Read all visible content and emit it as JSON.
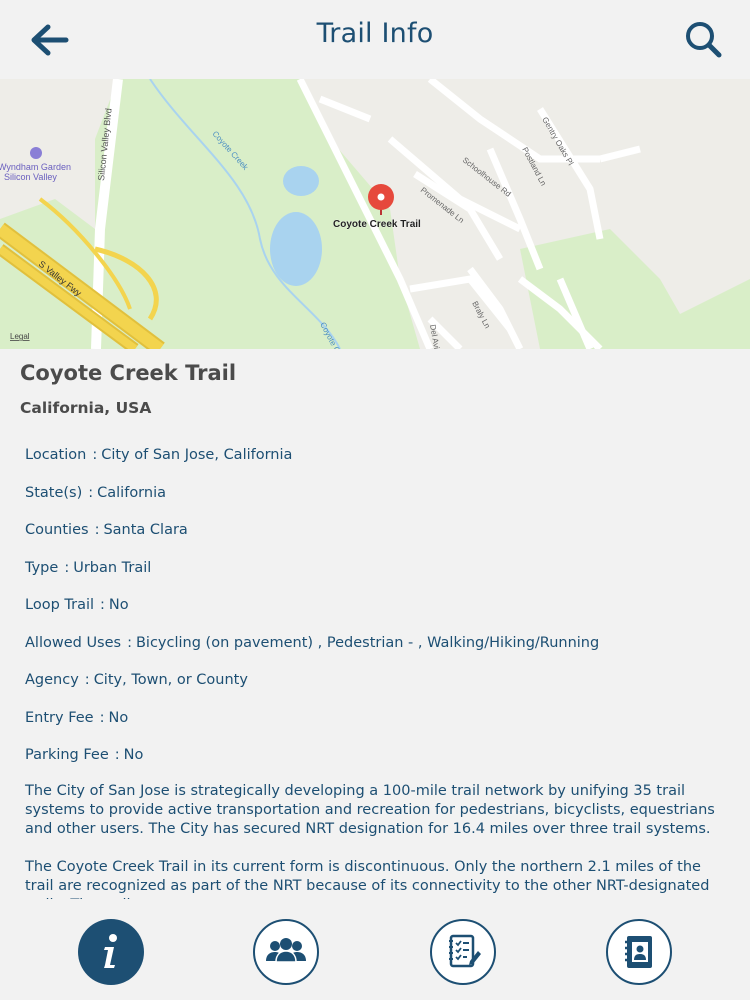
{
  "header": {
    "title": "Trail Info",
    "back_icon": "arrow-left-icon",
    "search_icon": "search-icon"
  },
  "map": {
    "pin_label": "Coyote Creek Trail",
    "legal_label": "Legal",
    "poi_label_line1": "Wyndham Garden",
    "poi_label_line2": "Silicon Valley",
    "streets": {
      "silicon_valley_blvd": "Silicon Valley Blvd",
      "s_valley_fwy": "S Valley Fwy",
      "coyote_creek_1": "Coyote Creek",
      "coyote_creek_2": "Coyote Cr",
      "schoolhouse_rd": "Schoolhouse Rd",
      "promenade_ln": "Promenade Ln",
      "postland_ln": "Postland Ln",
      "gentry_oaks_pl": "Gentry Oaks Pl",
      "braly_ln": "Braly Ln",
      "del_avi": "Del Avi"
    },
    "colors": {
      "park": "#d9eec8",
      "water": "#a9d3ef",
      "highway": "#f3d44e",
      "pin": "#e6493c"
    }
  },
  "trail": {
    "name": "Coyote Creek Trail",
    "region": "California, USA",
    "details": [
      {
        "label": "Location",
        "value": "City of San Jose, California"
      },
      {
        "label": "State(s)",
        "value": "California"
      },
      {
        "label": "Counties",
        "value": "Santa Clara"
      },
      {
        "label": "Type",
        "value": "Urban Trail"
      },
      {
        "label": "Loop Trail",
        "value": "No"
      },
      {
        "label": "Allowed Uses",
        "value": "Bicycling (on pavement) , Pedestrian - , Walking/Hiking/Running"
      },
      {
        "label": "Agency",
        "value": "City, Town, or County"
      },
      {
        "label": "Entry Fee",
        "value": "No"
      },
      {
        "label": "Parking Fee",
        "value": "No"
      }
    ],
    "description": [
      "The City of San Jose is strategically developing a 100-mile trail network by unifying 35 trail systems to provide active transportation and recreation for pedestrians, bicyclists, equestrians and other users. The City has secured NRT designation for 16.4 miles over three trail systems.",
      "The Coyote Creek Trail in its current form is discontinuous. Only the northern 2.1 miles of the trail are recognized as part of the NRT because of its connectivity to the other NRT-designated trails. The trail"
    ]
  },
  "tabs": [
    {
      "icon": "info-icon",
      "active": true
    },
    {
      "icon": "people-group-icon",
      "active": false
    },
    {
      "icon": "checklist-notes-icon",
      "active": false
    },
    {
      "icon": "contact-book-icon",
      "active": false
    }
  ],
  "colors": {
    "accent": "#1d4f73",
    "heading": "#4b4b4b",
    "background": "#f2f2f2"
  }
}
